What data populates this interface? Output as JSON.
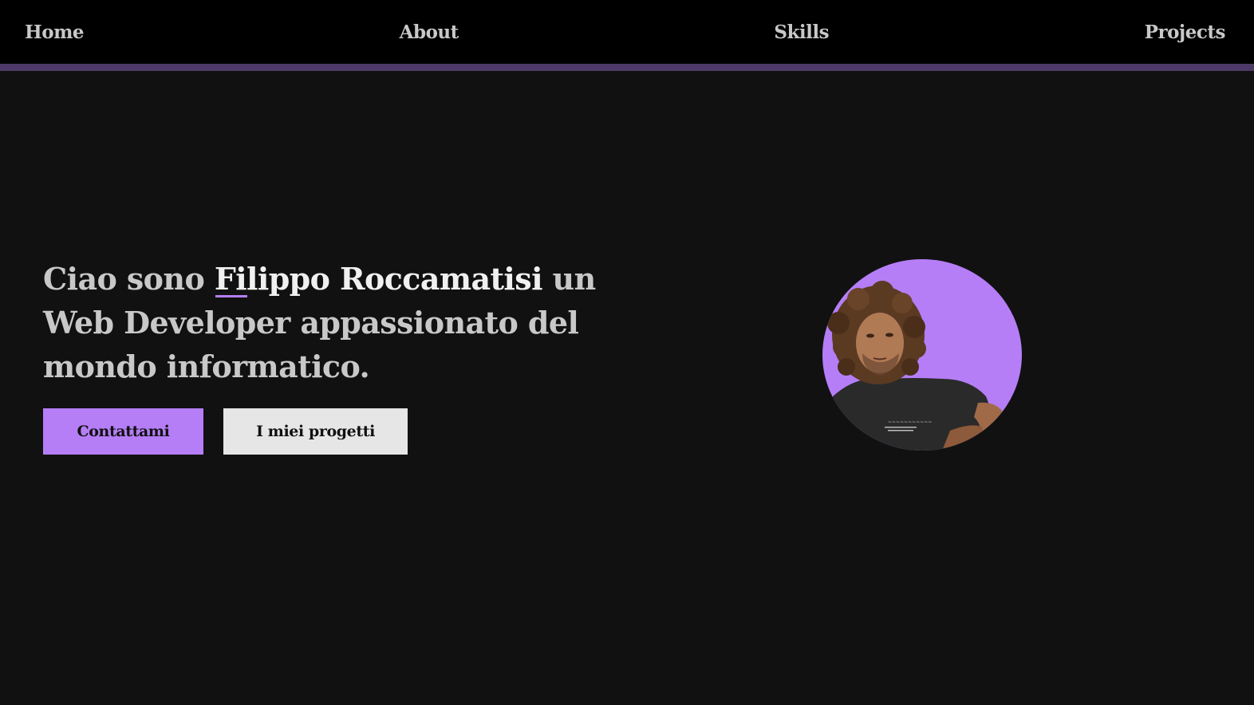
{
  "nav": {
    "items": [
      "Home",
      "About",
      "Skills",
      "Projects"
    ]
  },
  "hero": {
    "intro": "Ciao sono ",
    "name": "Filippo Roccamatisi",
    "rest": " un Web Developer appassionato del mondo informatico.",
    "contact_label": "Contattami",
    "projects_label": "I miei progetti"
  },
  "colors": {
    "accent": "#b57ef7",
    "background": "#111111",
    "navbar": "#000000",
    "nav_border": "#4e3a68",
    "secondary_button": "#e6e6e6"
  },
  "avatar": {
    "icon": "profile-photo"
  }
}
